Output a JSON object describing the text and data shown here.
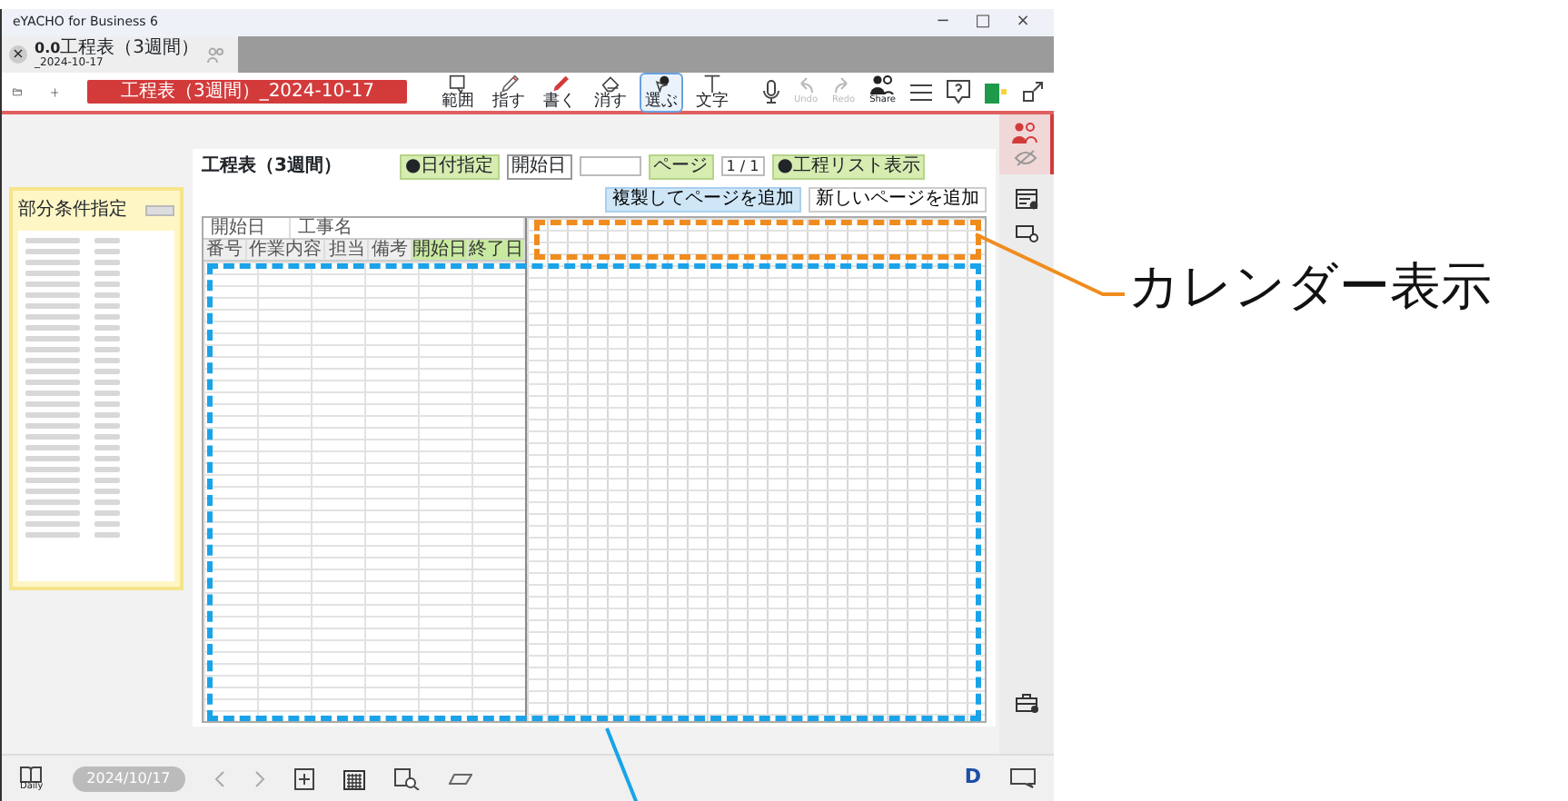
{
  "window": {
    "title": "eYACHO for Business 6",
    "controls": [
      "−",
      "□",
      "×"
    ]
  },
  "tab": {
    "close": "×",
    "version": "0.0",
    "title": "工程表（3週間）",
    "date": "_2024-10-17"
  },
  "toolbar": {
    "doc_title": "工程表（3週間）_2024-10-17",
    "tools": [
      {
        "label": "範囲",
        "selected": false
      },
      {
        "label": "指す",
        "selected": false
      },
      {
        "label": "書く",
        "selected": false
      },
      {
        "label": "消す",
        "selected": false
      },
      {
        "label": "選ぶ",
        "selected": true
      },
      {
        "label": "文字",
        "selected": false
      }
    ],
    "undo": {
      "label": "Undo",
      "disabled": true
    },
    "redo": {
      "label": "Redo",
      "disabled": true
    },
    "share": "Share"
  },
  "side_panel": {
    "title": "部分条件指定"
  },
  "document": {
    "title": "工程表（3週間）",
    "chips": [
      {
        "label": "●日付指定",
        "kind": "tag"
      },
      {
        "label": "開始日",
        "kind": "field"
      },
      {
        "label": "ページ",
        "kind": "pager",
        "value": "1 / 1"
      },
      {
        "label": "●工程リスト表示",
        "kind": "tag"
      }
    ],
    "buttons": [
      {
        "label": "複製してページを追加",
        "primary": true
      },
      {
        "label": "新しいページを追加",
        "primary": false
      }
    ],
    "header": [
      "開始日",
      "工事名"
    ],
    "columns": [
      {
        "label": "番号",
        "highlight": false
      },
      {
        "label": "作業内容",
        "highlight": false
      },
      {
        "label": "担当",
        "highlight": false
      },
      {
        "label": "備考",
        "highlight": false
      },
      {
        "label": "開始日",
        "highlight": true
      },
      {
        "label": "終了日",
        "highlight": true
      }
    ]
  },
  "bottom_bar": {
    "daily": "Daily",
    "date": "2024/10/17",
    "mode": "D"
  },
  "callouts": [
    {
      "label": "カレンダー表示"
    }
  ]
}
